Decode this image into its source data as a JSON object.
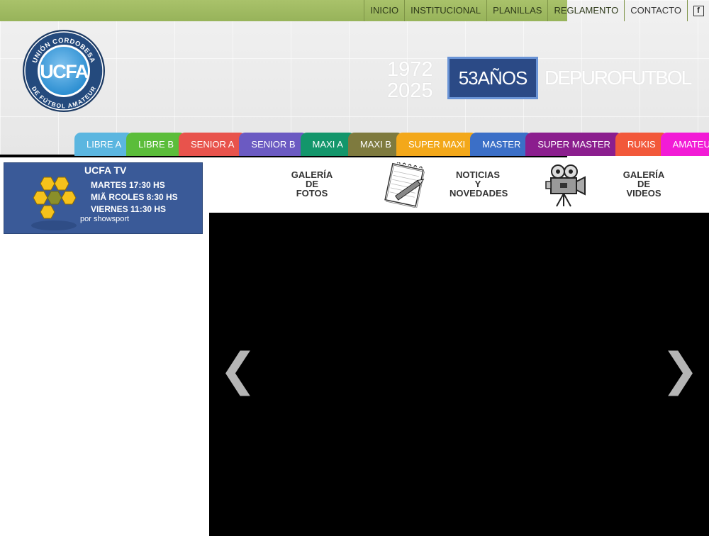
{
  "top_nav": {
    "items": [
      "INICIO",
      "INSTITUCIONAL",
      "PLANILLAS",
      "REGLAMENTO",
      "CONTACTO"
    ],
    "facebook_glyph": "f"
  },
  "logo": {
    "arc_top": "UNIÓN CORDOBESA",
    "arc_bottom": "DE FÚTBOL AMATEUR",
    "center": "UCFA",
    "icon": "ucfa-logo-icon"
  },
  "anniversary": {
    "year_start": "1972",
    "year_end": "2025",
    "years_label": "53AÑOS",
    "tagline": "DEPUROFUTBOL"
  },
  "category_tabs": [
    {
      "label": "LIBRE A",
      "color": "#5bb6e0"
    },
    {
      "label": "LIBRE B",
      "color": "#5bbd3a"
    },
    {
      "label": "SENIOR A",
      "color": "#e8534c"
    },
    {
      "label": "SENIOR B",
      "color": "#6b5ac2"
    },
    {
      "label": "MAXI A",
      "color": "#13966b"
    },
    {
      "label": "MAXI B",
      "color": "#7e7a3e"
    },
    {
      "label": "SUPER MAXI",
      "color": "#f3a81a"
    },
    {
      "label": "MASTER",
      "color": "#3b6fc7"
    },
    {
      "label": "SUPER MASTER",
      "color": "#8b1e8e"
    },
    {
      "label": "RUKIS",
      "color": "#f2583a"
    },
    {
      "label": "AMATEUR",
      "color": "#f21bd6"
    }
  ],
  "tv_banner": {
    "title": "UCFA TV",
    "lines": [
      "MARTES 17:30 HS",
      "MIÃ  RCOLES 8:30 HS",
      "VIERNES 11:30 HS"
    ],
    "by": "por showsport",
    "colors": {
      "background": "#3a5a98",
      "hex_fill": "#f6c21b"
    }
  },
  "galleries": {
    "photos": {
      "line1": "GALERÍA",
      "line2": "DE",
      "line3": "FOTOS"
    },
    "news": {
      "line1": "NOTICIAS",
      "line2": "Y",
      "line3": "NOVEDADES",
      "icon": "notepad-pen-icon"
    },
    "videos": {
      "line1": "GALERÍA",
      "line2": "DE",
      "line3": "VIDEOS",
      "icon": "film-camera-icon"
    }
  },
  "slider": {
    "prev_glyph": "❮",
    "next_glyph": "❯"
  },
  "colors": {
    "green_bar": "#a0bb62",
    "years_box": "#2b4a86"
  }
}
